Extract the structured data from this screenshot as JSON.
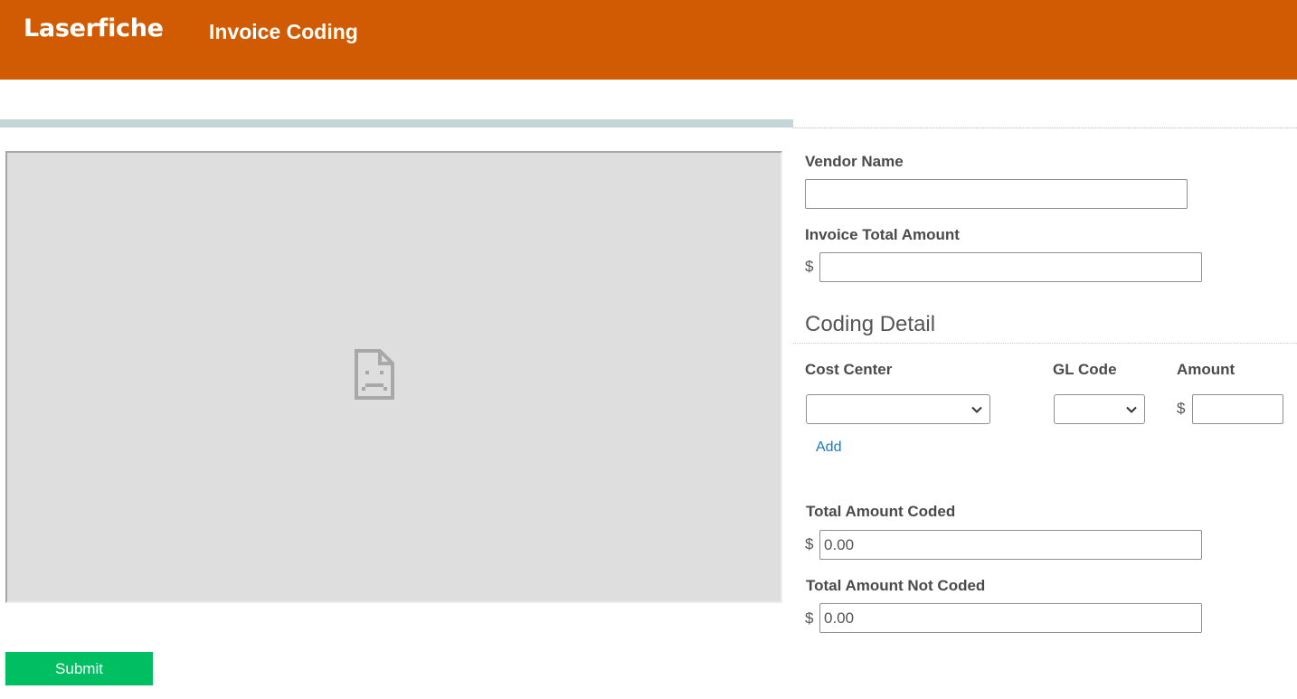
{
  "header": {
    "logo_text": "Laserfiche",
    "form_title": "Invoice Coding",
    "background_color": "#d15b03"
  },
  "viewer": {
    "icon": "broken-document-icon"
  },
  "fields": {
    "vendor_name": {
      "label": "Vendor Name",
      "value": ""
    },
    "invoice_total": {
      "label": "Invoice Total Amount",
      "currency": "$",
      "value": ""
    }
  },
  "coding_detail": {
    "title": "Coding Detail",
    "columns": {
      "cost_center": "Cost Center",
      "gl_code": "GL Code",
      "amount": "Amount"
    },
    "row": {
      "cost_center": "",
      "gl_code": "",
      "currency": "$",
      "amount": ""
    },
    "add_label": "Add"
  },
  "totals": {
    "coded": {
      "label": "Total Amount Coded",
      "currency": "$",
      "value": "0.00"
    },
    "not_coded": {
      "label": "Total Amount Not Coded",
      "currency": "$",
      "value": "0.00"
    }
  },
  "submit": {
    "label": "Submit",
    "color": "#00bf63"
  }
}
